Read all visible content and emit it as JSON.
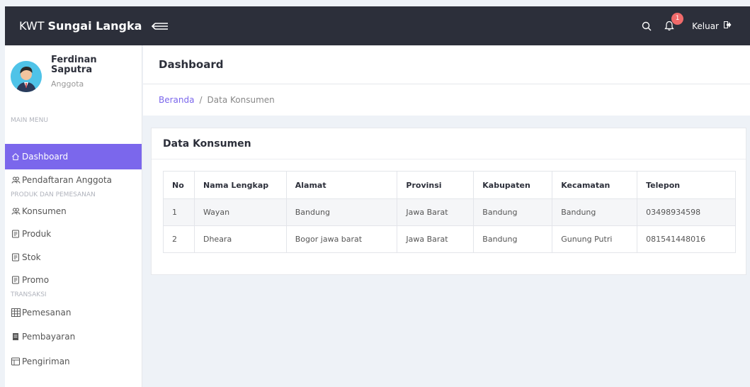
{
  "brand": {
    "prefix": "KWT",
    "name": "Sungai Langka"
  },
  "topbar": {
    "logout_label": "Keluar",
    "notification_count": "1"
  },
  "profile": {
    "name": "Ferdinan Saputra",
    "role": "Anggota"
  },
  "sidebar": {
    "section_main": "MAIN MENU",
    "section_products": "PRODUK DAN PEMESANAN",
    "section_transactions": "TRANSAKSI",
    "items": {
      "dashboard": "Dashboard",
      "member_registration": "Pendaftaran Anggota",
      "consumers": "Konsumen",
      "products": "Produk",
      "stock": "Stok",
      "promo": "Promo",
      "orders": "Pemesanan",
      "payments": "Pembayaran",
      "shipping": "Pengiriman"
    }
  },
  "page": {
    "title": "Dashboard",
    "breadcrumb_home": "Beranda",
    "breadcrumb_separator": "/",
    "breadcrumb_current": "Data Konsumen"
  },
  "card": {
    "title": "Data Konsumen",
    "columns": [
      "No",
      "Nama Lengkap",
      "Alamat",
      "Provinsi",
      "Kabupaten",
      "Kecamatan",
      "Telepon"
    ],
    "rows": [
      [
        "1",
        "Wayan",
        "Bandung",
        "Jawa Barat",
        "Bandung",
        "Bandung",
        "03498934598"
      ],
      [
        "2",
        "Dheara",
        "Bogor jawa barat",
        "Jawa Barat",
        "Bandung",
        "Gunung Putri",
        "081541448016"
      ]
    ]
  },
  "colors": {
    "topbar": "#2c2f3a",
    "accent": "#7b67ec",
    "badge": "#f06a6a",
    "avatar_bg": "#4fc3e8"
  }
}
